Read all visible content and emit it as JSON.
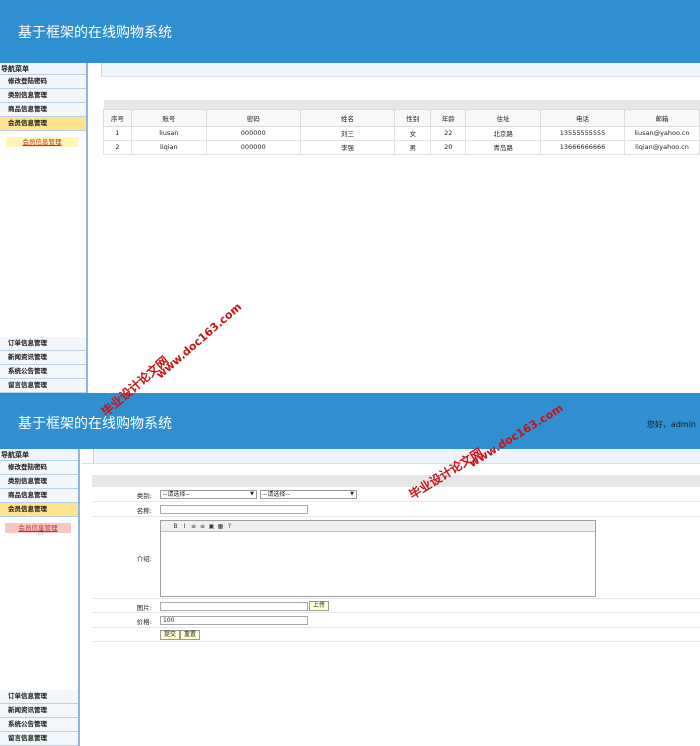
{
  "app": {
    "title": "基于框架的在线购物系统"
  },
  "greeting": "您好，admin",
  "nav": {
    "header": "导航菜单",
    "top_items": [
      "修改登陆密码",
      "类别信息管理",
      "商品信息管理",
      "会员信息管理"
    ],
    "active_item": "会员信息管理",
    "sub_item": "会员信息管理",
    "bottom_items": [
      "订单信息管理",
      "新闻资讯管理",
      "系统公告管理",
      "留言信息管理"
    ]
  },
  "member_table": {
    "columns": [
      "序号",
      "账号",
      "密码",
      "姓名",
      "性别",
      "年龄",
      "住址",
      "电话",
      "邮箱"
    ],
    "rows": [
      [
        "1",
        "liusan",
        "000000",
        "刘三",
        "女",
        "22",
        "北京路",
        "13555555555",
        "liusan@yahoo.cn"
      ],
      [
        "2",
        "liqian",
        "000000",
        "李强",
        "男",
        "20",
        "青岛路",
        "13666666666",
        "liqian@yahoo.cn"
      ]
    ]
  },
  "product_form": {
    "category_label": "类别:",
    "category_select_1": "--请选择--",
    "category_select_2": "--请选择--",
    "name_label": "名称:",
    "intro_label": "介绍:",
    "editor_tools": [
      "B",
      "I",
      "≡",
      "≡",
      "▣",
      "▦",
      "?"
    ],
    "image_label": "图片:",
    "upload_button": "上传",
    "price_label": "价格:",
    "price_value": "100",
    "submit_button": "提交",
    "reset_button": "重置"
  },
  "watermark": {
    "site_1": "www.doc163.com",
    "brand_1": "毕业设计论文网",
    "site_2": "www.doc163.com",
    "brand_2": "毕业设计论文网"
  },
  "colors": {
    "header": "#2f8fd0",
    "active_nav": "#ffe38f",
    "watermark": "#cc1111"
  }
}
